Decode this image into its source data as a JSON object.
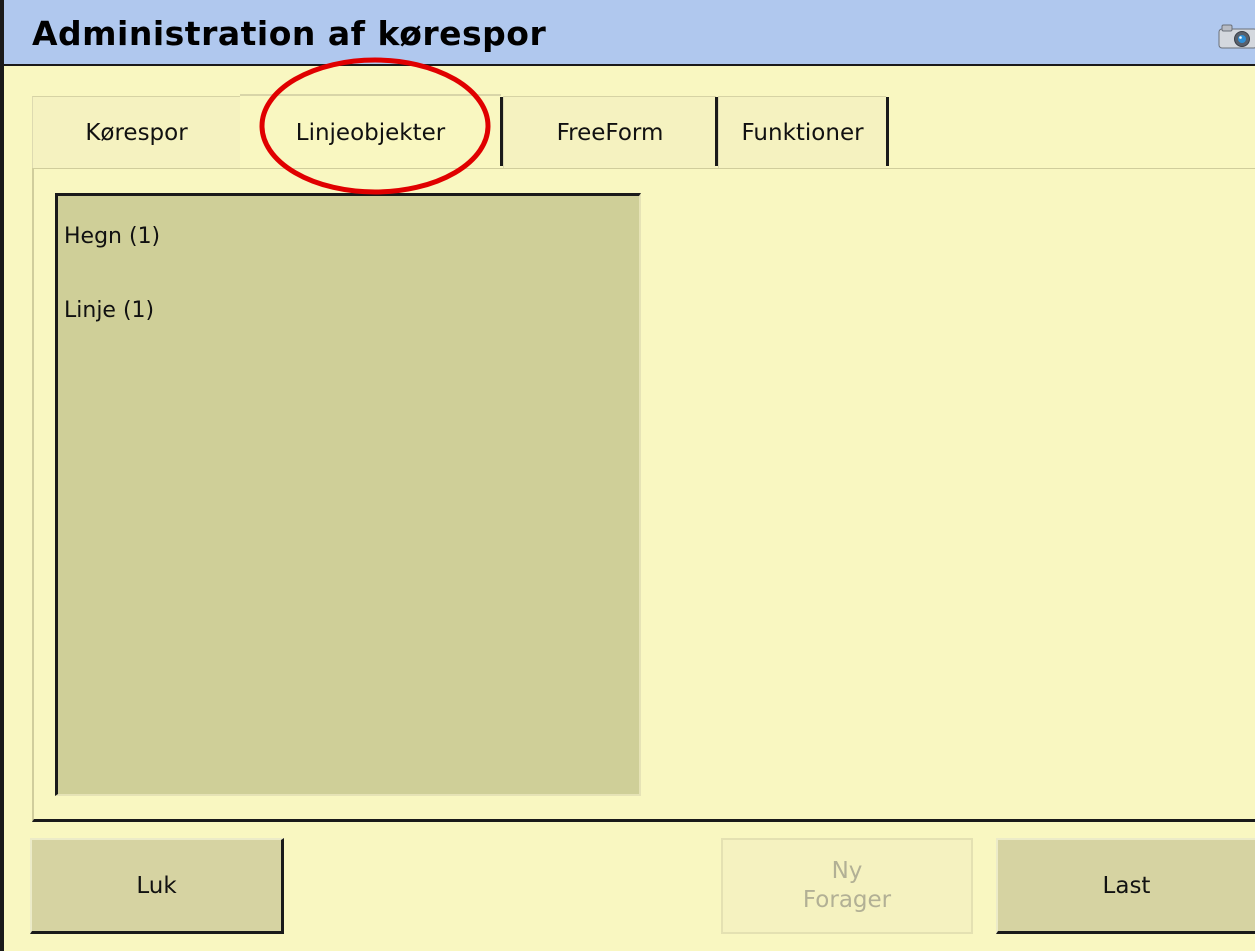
{
  "window": {
    "title": "Administration af kørespor",
    "icon": "camera-icon"
  },
  "tabs": [
    {
      "label": "Kørespor",
      "active": false
    },
    {
      "label": "Linjeobjekter",
      "active": true
    },
    {
      "label": "FreeForm",
      "active": false
    },
    {
      "label": "Funktioner",
      "active": false
    }
  ],
  "list": {
    "items": [
      {
        "label": "Hegn (1)"
      },
      {
        "label": "Linje (1)"
      }
    ]
  },
  "buttons": {
    "close": {
      "label": "Luk"
    },
    "new_forager": {
      "line1": "Ny",
      "line2": "Forager",
      "enabled": false
    },
    "load": {
      "label": "Last"
    }
  },
  "annotation": {
    "color": "#e00000"
  },
  "colors": {
    "background": "#f9f7c1",
    "titlebar": "#b0c8ee",
    "list_background": "#cfcf98",
    "button": "#d6d3a2"
  }
}
